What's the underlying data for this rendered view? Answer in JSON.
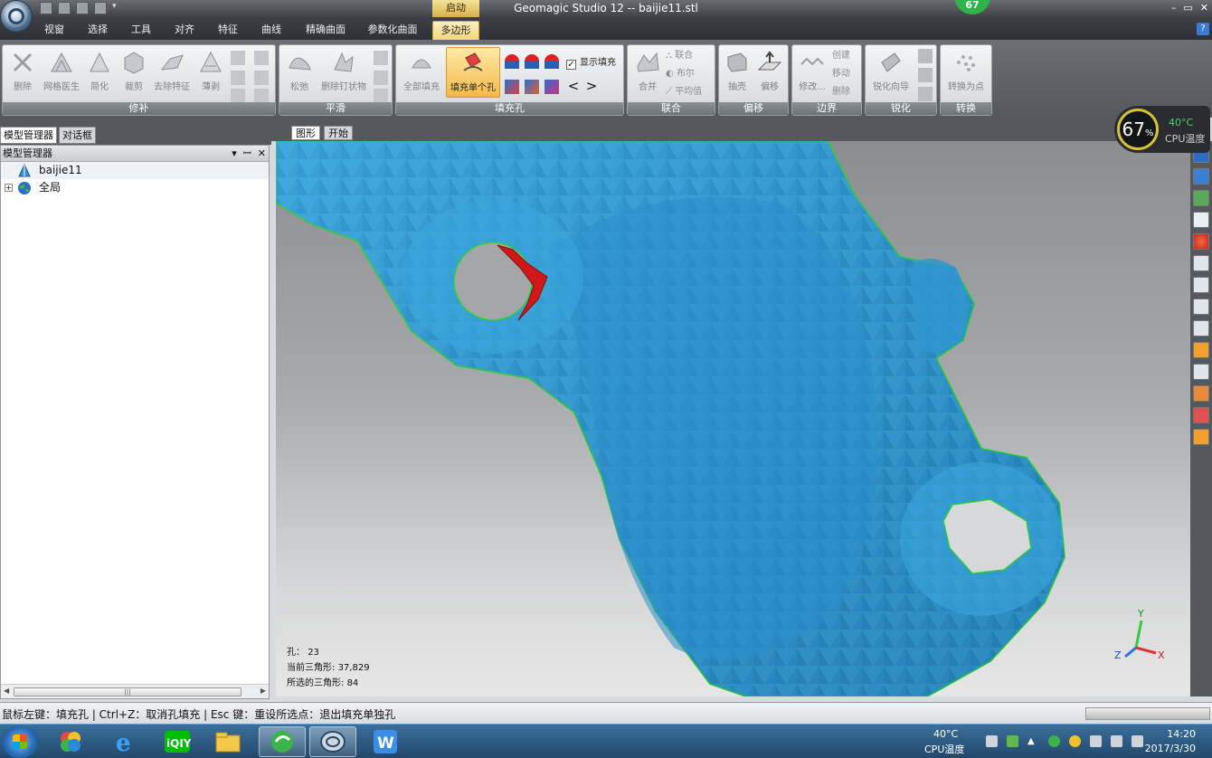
{
  "window": {
    "title": "Geomagic Studio 12 -- baijie11.stl",
    "context_tab": "启动",
    "badge_value": "67"
  },
  "ribbon_tabs": [
    "视窗",
    "选择",
    "工具",
    "对齐",
    "特征",
    "曲线",
    "精确曲面",
    "参数化曲面",
    "多边形"
  ],
  "ribbon": {
    "groups": {
      "repair": "修补",
      "smooth": "平滑",
      "fill": "填充孔",
      "combine": "联合",
      "offset": "偏移",
      "boundary": "边界",
      "sharpen": "锐化",
      "convert": "转换"
    },
    "buttons": {
      "delete": "删除",
      "mesh_doctor": "网格医生",
      "simplify": "简化",
      "trim": "裁剪",
      "remove_features": "去除特征",
      "shell": "薄剥",
      "relax": "松弛",
      "remove_spikes": "删除钉状物",
      "fill_all": "全部填充",
      "fill_single": "填充单个孔",
      "show_fill": "显示填充",
      "merge": "合并",
      "combine_small": "联合",
      "boolean": "布尔",
      "average": "平均值",
      "extract": "抽壳",
      "offset": "偏移",
      "modify": "修改...",
      "create": "创建",
      "move": "移动",
      "delete_small": "删除",
      "sharpen_wizard": "锐化向导",
      "convert_points": "转换为点"
    }
  },
  "cpu_widget": {
    "percent": "67",
    "percent_sign": "%",
    "temperature": "40°C",
    "label": "CPU温度"
  },
  "left_panel": {
    "tabs": [
      "模型管理器",
      "对话框"
    ],
    "header": "模型管理器",
    "tree": [
      {
        "label": "baijie11",
        "icon": "mesh-icon"
      },
      {
        "label": "全局",
        "icon": "globe-icon"
      }
    ]
  },
  "viewport": {
    "tabs": [
      "图形",
      "开始"
    ],
    "stats": {
      "holes_label": "孔：",
      "holes_value": "23",
      "triangles_label": "当前三角形:",
      "triangles_value": "37,829",
      "selected_label": "所选的三角形:",
      "selected_value": "84"
    },
    "axis": {
      "x": "X",
      "y": "Y",
      "z": "Z"
    },
    "colors": {
      "mesh": "#2a8fc7",
      "selected": "#d01818",
      "boundary": "#2ecc40"
    }
  },
  "status": {
    "text": "鼠标左键：填充孔 | Ctrl+Z：取消孔填充 | Esc 键：重设所选点：退出填充单独孔"
  },
  "taskbar": {
    "tray_temp": "40°C",
    "tray_cpu": "CPU温度",
    "time": "14:20",
    "date": "2017/3/30"
  }
}
